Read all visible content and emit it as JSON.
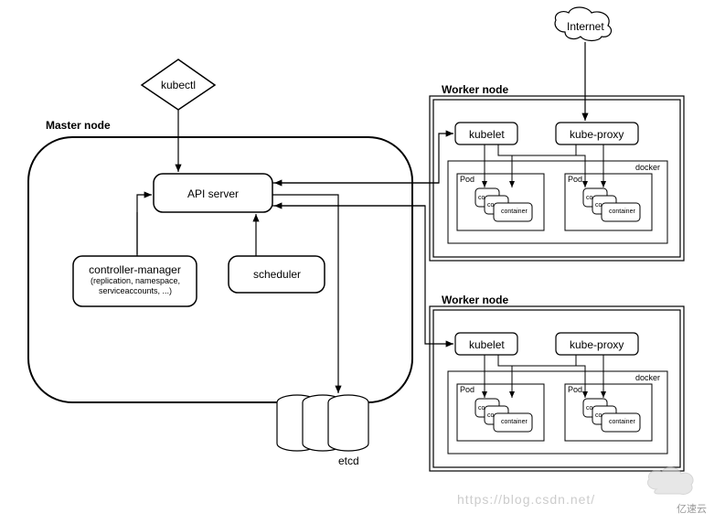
{
  "internet": "Internet",
  "kubectl": "kubectl",
  "master": {
    "title": "Master node",
    "api_server": "API server",
    "controller_manager": "controller-manager",
    "controller_manager_sub": "(replication, namespace,\nserviceaccounts, ...)",
    "scheduler": "scheduler",
    "etcd": "etcd"
  },
  "worker1": {
    "title": "Worker node",
    "kubelet": "kubelet",
    "kube_proxy": "kube-proxy",
    "docker": "docker",
    "pod": "Pod",
    "container": "container",
    "co": "co"
  },
  "worker2": {
    "title": "Worker node",
    "kubelet": "kubelet",
    "kube_proxy": "kube-proxy",
    "docker": "docker",
    "pod": "Pod",
    "container": "container",
    "co": "co"
  },
  "watermark": "https://blog.csdn.net/",
  "logo": "亿速云"
}
